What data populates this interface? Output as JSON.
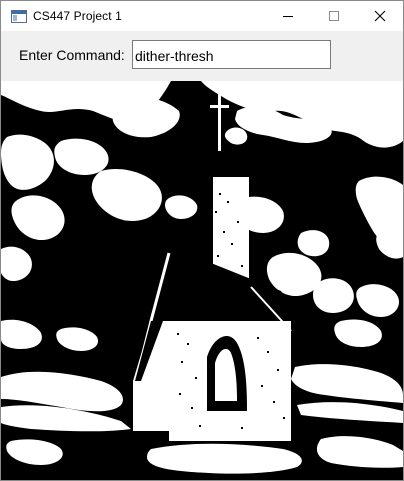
{
  "window": {
    "title": "CS447 Project 1",
    "icon": "app-window-icon",
    "controls": [
      "minimize-icon",
      "maximize-icon",
      "close-icon"
    ]
  },
  "command": {
    "label": "Enter Command:",
    "value": "dither-thresh"
  },
  "canvas": {
    "content": "dithered-threshold-church-image",
    "colors": {
      "background": "#000000",
      "foreground": "#ffffff"
    }
  }
}
